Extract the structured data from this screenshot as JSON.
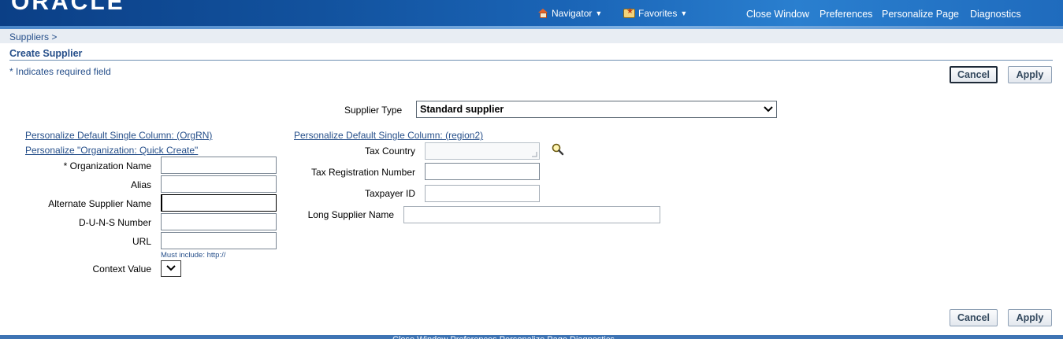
{
  "header": {
    "logo_text": "ORACLE",
    "navigator_label": "Navigator",
    "favorites_label": "Favorites",
    "links": {
      "close_window": "Close Window",
      "preferences": "Preferences",
      "personalize_page": "Personalize Page",
      "diagnostics": "Diagnostics"
    }
  },
  "breadcrumb": "Suppliers  >",
  "page_title": "Create Supplier",
  "required_note": "*   Indicates required field",
  "buttons": {
    "cancel": "Cancel",
    "apply": "Apply"
  },
  "supplier_type": {
    "label": "Supplier Type",
    "selected": "Standard supplier"
  },
  "left_region": {
    "personalize_link_1": "Personalize Default Single Column: (OrgRN)",
    "personalize_link_2": "Personalize \"Organization: Quick Create\"",
    "fields": {
      "organization_name": {
        "label": "* Organization Name",
        "value": ""
      },
      "alias": {
        "label": "Alias",
        "value": ""
      },
      "alternate_supplier_name": {
        "label": "Alternate Supplier Name",
        "value": ""
      },
      "duns_number": {
        "label": "D-U-N-S Number",
        "value": ""
      },
      "url": {
        "label": "URL",
        "value": "",
        "hint": "Must include: http://"
      },
      "context_value": {
        "label": "Context Value",
        "value": ""
      }
    }
  },
  "right_region": {
    "personalize_link": "Personalize Default Single Column: (region2)",
    "fields": {
      "tax_country": {
        "label": "Tax Country",
        "value": ""
      },
      "tax_registration_number": {
        "label": "Tax Registration Number",
        "value": ""
      },
      "taxpayer_id": {
        "label": "Taxpayer ID",
        "value": ""
      },
      "long_supplier_name": {
        "label": "Long Supplier Name",
        "value": ""
      }
    }
  },
  "footer_links": "Close Window    Preferences    Personalize Page    Diagnostics",
  "colors": {
    "link": "#264f8a",
    "header_dark": "#0b3f86",
    "header_light": "#2a7fcf"
  },
  "icons": [
    "home-icon",
    "favorites-icon",
    "caret-down-icon",
    "search-icon",
    "chevron-down-icon"
  ]
}
